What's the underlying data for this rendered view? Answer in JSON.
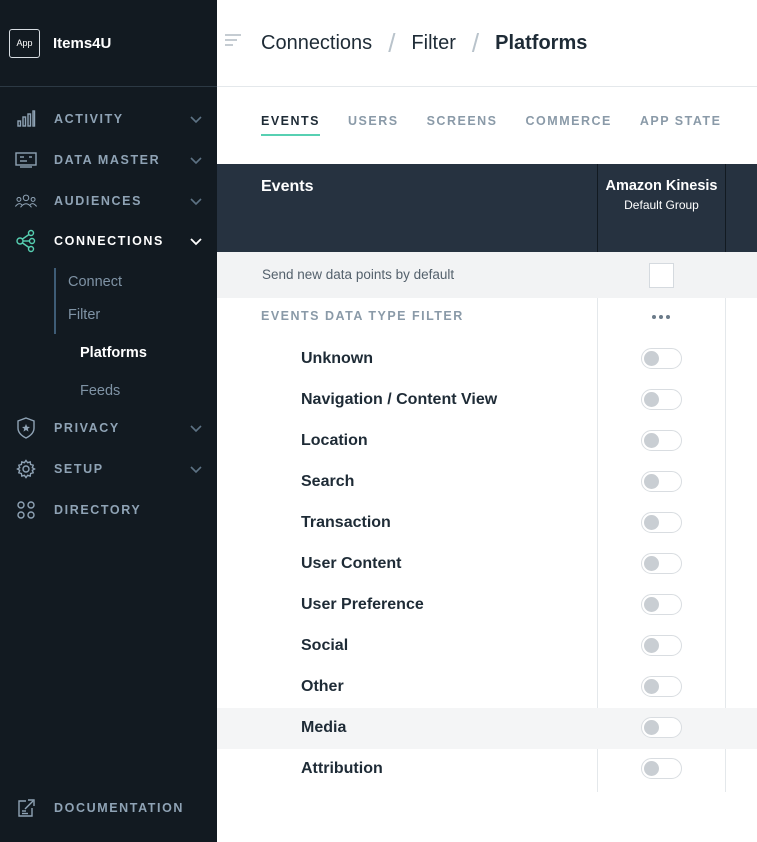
{
  "app": {
    "badge": "App",
    "name": "Items4U"
  },
  "sidebar": {
    "items": [
      {
        "label": "ACTIVITY",
        "icon": "activity-icon"
      },
      {
        "label": "DATA MASTER",
        "icon": "data-master-icon"
      },
      {
        "label": "AUDIENCES",
        "icon": "audiences-icon"
      },
      {
        "label": "CONNECTIONS",
        "icon": "connections-icon"
      },
      {
        "label": "PRIVACY",
        "icon": "privacy-icon"
      },
      {
        "label": "SETUP",
        "icon": "gear-icon"
      },
      {
        "label": "DIRECTORY",
        "icon": "directory-icon"
      }
    ],
    "sub_items": [
      "Connect",
      "Filter",
      "Platforms",
      "Feeds"
    ],
    "documentation": "DOCUMENTATION",
    "colors": {
      "background": "#121a21",
      "accent": "#57d0b2"
    }
  },
  "breadcrumb": [
    "Connections",
    "Filter",
    "Platforms"
  ],
  "tabs": [
    "EVENTS",
    "USERS",
    "SCREENS",
    "COMMERCE",
    "APP STATE"
  ],
  "table": {
    "header": {
      "events": "Events",
      "column_name": "Amazon Kinesis",
      "column_sub": "Default Group"
    },
    "default_row": "Send new data points by default",
    "filter_label": "EVENTS DATA TYPE FILTER",
    "rows": [
      {
        "label": "Unknown",
        "enabled": false
      },
      {
        "label": "Navigation / Content View",
        "enabled": false
      },
      {
        "label": "Location",
        "enabled": false
      },
      {
        "label": "Search",
        "enabled": false
      },
      {
        "label": "Transaction",
        "enabled": false
      },
      {
        "label": "User Content",
        "enabled": false
      },
      {
        "label": "User Preference",
        "enabled": false
      },
      {
        "label": "Social",
        "enabled": false
      },
      {
        "label": "Other",
        "enabled": false
      },
      {
        "label": "Media",
        "enabled": false
      },
      {
        "label": "Attribution",
        "enabled": false
      }
    ]
  }
}
